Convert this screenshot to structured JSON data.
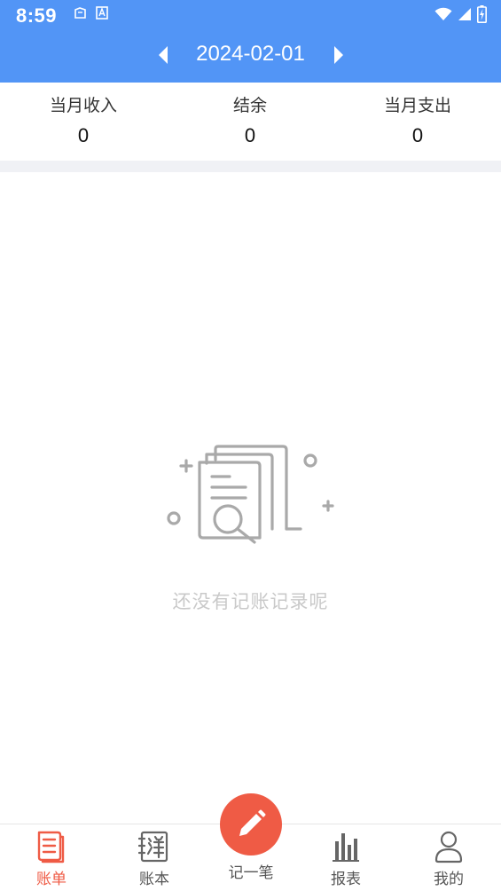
{
  "status_bar": {
    "time": "8:59",
    "icons": [
      "notification-icon",
      "text-a-icon",
      "wifi-icon",
      "cell-signal-icon",
      "battery-charging-icon"
    ]
  },
  "header": {
    "date": "2024-02-01",
    "prev_icon": "triangle-left-icon",
    "next_icon": "triangle-right-icon",
    "background": "#5295f6"
  },
  "summary": {
    "income_label": "当月收入",
    "income_value": "0",
    "balance_label": "结余",
    "balance_value": "0",
    "expense_label": "当月支出",
    "expense_value": "0"
  },
  "empty_state": {
    "icon": "document-search-icon",
    "message": "还没有记账记录呢"
  },
  "tabbar": {
    "active_color": "#ef5b45",
    "tabs": [
      {
        "label": "账单",
        "icon": "bill-icon",
        "active": true
      },
      {
        "label": "账本",
        "icon": "ledger-icon",
        "active": false
      },
      {
        "label": "记一笔",
        "icon": "pencil-icon",
        "active": false
      },
      {
        "label": "报表",
        "icon": "bar-chart-icon",
        "active": false
      },
      {
        "label": "我的",
        "icon": "user-icon",
        "active": false
      }
    ]
  }
}
